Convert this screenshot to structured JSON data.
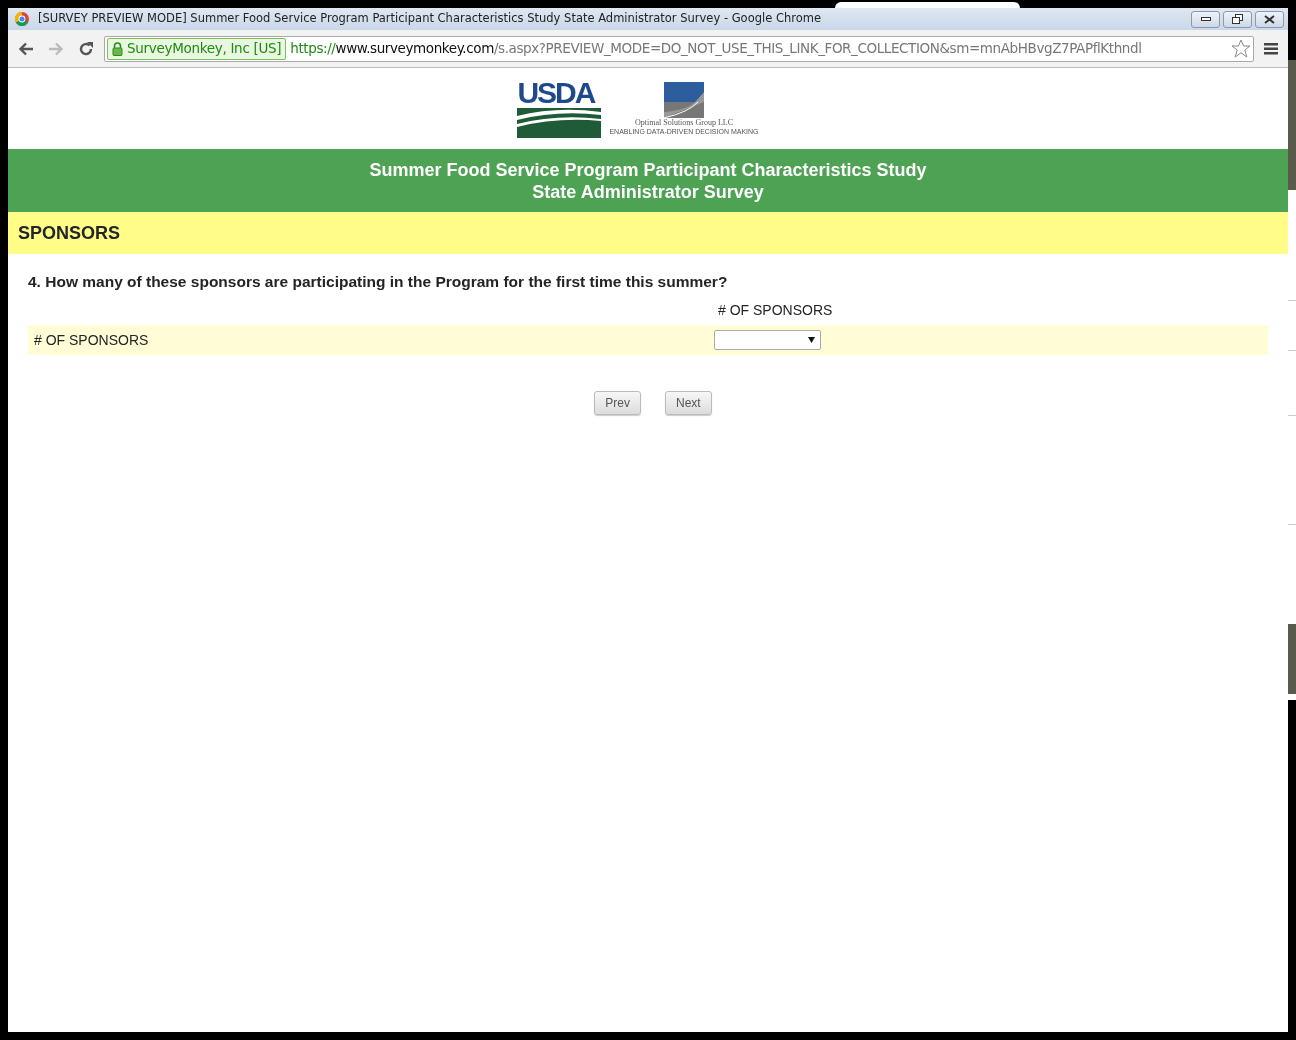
{
  "window": {
    "title": "[SURVEY PREVIEW MODE] Summer Food Service Program Participant Characteristics Study State Administrator Survey - Google Chrome"
  },
  "toolbar": {
    "back_disabled": false,
    "forward_disabled": true,
    "security_label": "SurveyMonkey, Inc [US]",
    "url_scheme": "https://",
    "url_host": "www.surveymonkey.com",
    "url_rest": "/s.aspx?PREVIEW_MODE=DO_NOT_USE_THIS_LINK_FOR_COLLECTION&sm=mnAbHBvgZ7PAPflKthndl"
  },
  "logos": {
    "usda": "USDA",
    "optimal_name": "Optimal Solutions Group LLC",
    "optimal_tagline": "ENABLING DATA-DRIVEN DECISION MAKING"
  },
  "survey": {
    "title_lines": [
      "Summer Food Service Program Participant Characteristics Study",
      "State Administrator Survey"
    ],
    "section": "SPONSORS",
    "question": "4. How many of these sponsors are participating in the Program for the first time this summer?",
    "column_header": "# OF SPONSORS",
    "rows": [
      {
        "label": "# OF SPONSORS"
      }
    ],
    "buttons": [
      "Prev",
      "Next"
    ]
  }
}
